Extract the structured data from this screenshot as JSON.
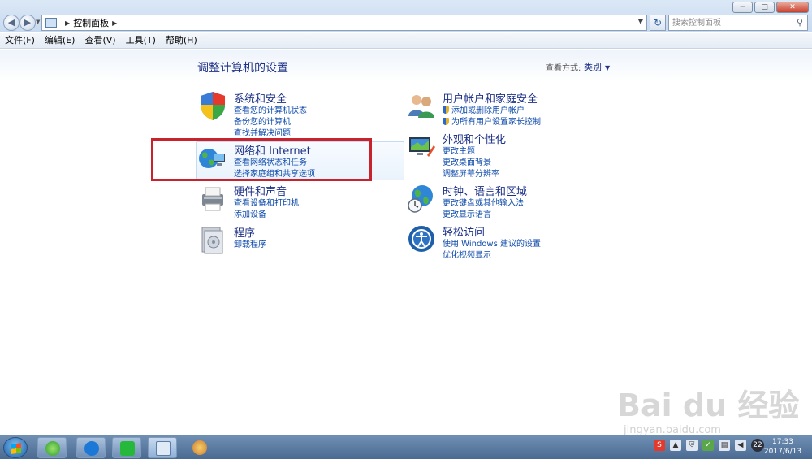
{
  "window": {
    "address": "控制面板",
    "search_placeholder": "搜索控制面板",
    "controls": {
      "minimize": "─",
      "maximize": "□",
      "close": "✕"
    }
  },
  "menu": [
    "文件(F)",
    "编辑(E)",
    "查看(V)",
    "工具(T)",
    "帮助(H)"
  ],
  "page": {
    "title": "调整计算机的设置",
    "view_by_label": "查看方式:",
    "view_by_value": "类别"
  },
  "categories": [
    {
      "title": "系统和安全",
      "icon": "shield-security-icon",
      "links": [
        "查看您的计算机状态",
        "备份您的计算机",
        "查找并解决问题"
      ]
    },
    {
      "title": "网络和 Internet",
      "icon": "network-globe-icon",
      "links": [
        "查看网络状态和任务",
        "选择家庭组和共享选项"
      ]
    },
    {
      "title": "硬件和声音",
      "icon": "printer-icon",
      "links": [
        "查看设备和打印机",
        "添加设备"
      ]
    },
    {
      "title": "程序",
      "icon": "programs-icon",
      "links": [
        "卸载程序"
      ]
    },
    {
      "title": "用户帐户和家庭安全",
      "icon": "users-icon",
      "links": [
        "添加或删除用户帐户",
        "为所有用户设置家长控制"
      ]
    },
    {
      "title": "外观和个性化",
      "icon": "appearance-icon",
      "links": [
        "更改主题",
        "更改桌面背景",
        "调整屏幕分辨率"
      ]
    },
    {
      "title": "时钟、语言和区域",
      "icon": "clock-globe-icon",
      "links": [
        "更改键盘或其他输入法",
        "更改显示语言"
      ]
    },
    {
      "title": "轻松访问",
      "icon": "ease-of-access-icon",
      "links": [
        "使用 Windows 建议的设置",
        "优化视频显示"
      ]
    }
  ],
  "watermark": {
    "main": "Bai du 经验",
    "sub": "jingyan.baidu.com"
  },
  "taskbar": {
    "badge": "22",
    "time": "17:33",
    "date": "2017/6/13"
  },
  "colors": {
    "highlight_box": "#c8232c",
    "link": "#0e4aaa",
    "title": "#1e3287"
  }
}
